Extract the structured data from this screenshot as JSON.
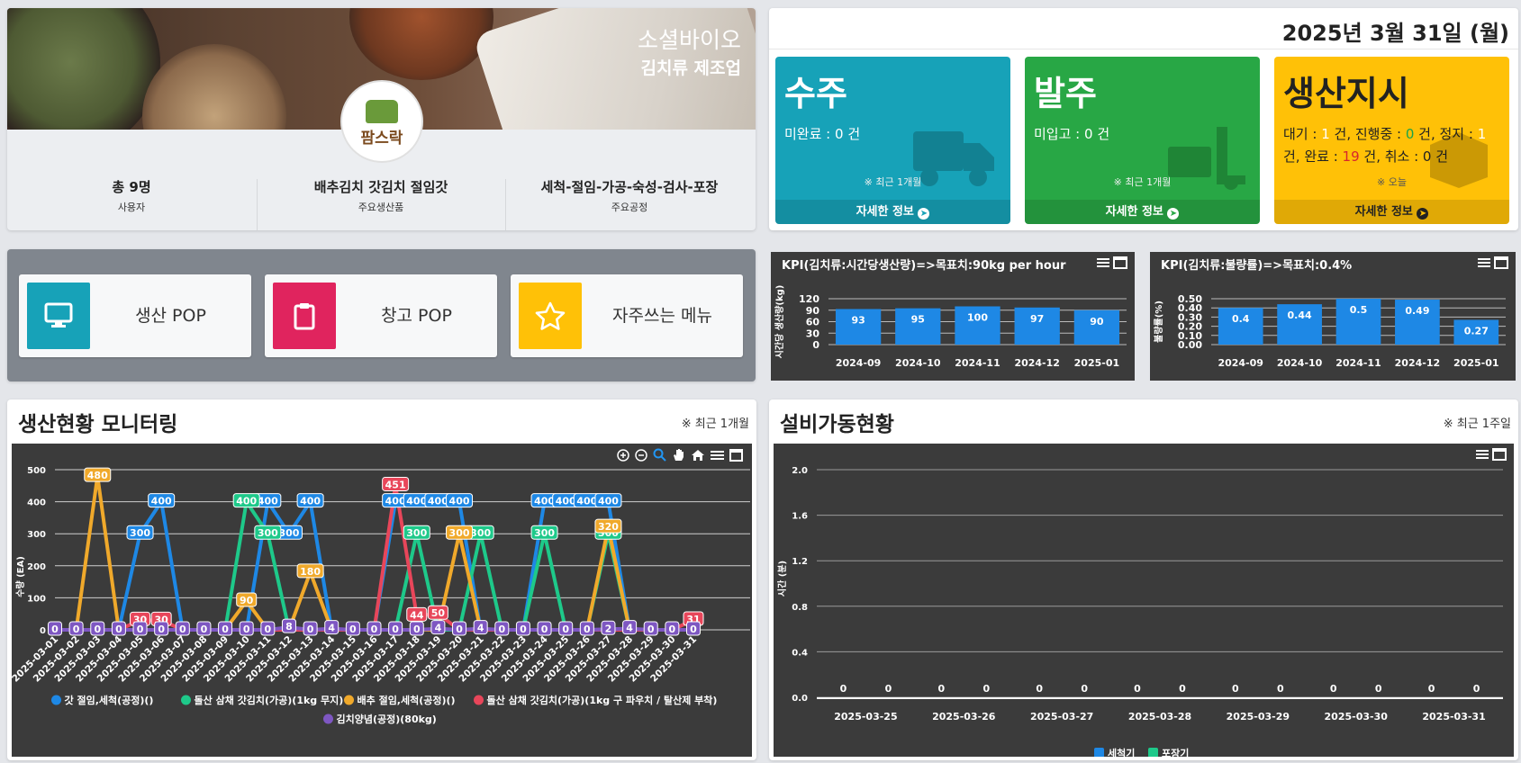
{
  "company": {
    "name": "소셜바이오",
    "industry": "김치류 제조업"
  },
  "logo_text": "팜스락",
  "stats": [
    {
      "value": "총 9명",
      "label": "사용자"
    },
    {
      "value": "배추김치 갓김치 절임갓",
      "label": "주요생산품"
    },
    {
      "value": "세척-절임-가공-숙성-검사-포장",
      "label": "주요공정"
    }
  ],
  "date": "2025년 3월 31일 (월)",
  "boxes": {
    "order": {
      "title": "수주",
      "desc_label": "미완료 : ",
      "count": "0",
      "unit": " 건",
      "period": "※ 최근 1개월",
      "more": "자세한 정보",
      "color": "#17a2b8"
    },
    "purchase": {
      "title": "발주",
      "desc_label": "미입고 : ",
      "count": "0",
      "unit": " 건",
      "period": "※ 최근 1개월",
      "more": "자세한 정보",
      "color": "#28a745"
    },
    "production": {
      "title": "생산지시",
      "wait_label": "대기 : ",
      "wait": "1",
      "progress_label": " 건, 진행중 : ",
      "progress": "0",
      "stop_label": " 건, 정지 : ",
      "stop": "1",
      "done_label": " 건, 완료 : ",
      "done": "19",
      "cancel_label": " 건, 취소 : ",
      "cancel": "0",
      "unit": " 건",
      "period": "※ 오늘",
      "more": "자세한 정보",
      "color": "#ffc107"
    }
  },
  "pop_buttons": [
    {
      "label": "생산 POP",
      "icon": "monitor-icon",
      "color": "#17a2b8"
    },
    {
      "label": "창고 POP",
      "icon": "clipboard-icon",
      "color": "#e0245e"
    },
    {
      "label": "자주쓰는 메뉴",
      "icon": "star-icon",
      "color": "#ffc107"
    }
  ],
  "monitor_title": "생산현황 모니터링",
  "monitor_note": "※ 최근 1개월",
  "equip_title": "설비가동현황",
  "equip_note": "※ 최근 1주일",
  "chart_data": [
    {
      "type": "bar",
      "title": "KPI(김치류:시간당생산량)=>목표치:90kg per hour",
      "ylabel": "시간당 생산량(kg)",
      "categories": [
        "2024-09",
        "2024-10",
        "2024-11",
        "2024-12",
        "2025-01"
      ],
      "values": [
        93,
        95,
        100,
        97,
        90
      ],
      "yticks": [
        "0",
        "30",
        "60",
        "90",
        "120"
      ],
      "ylim": [
        0,
        120
      ],
      "color": "#1e88e5"
    },
    {
      "type": "bar",
      "title": "KPI(김치류:불량률)=>목표치:0.4%",
      "ylabel": "불량률(%)",
      "categories": [
        "2024-09",
        "2024-10",
        "2024-11",
        "2024-12",
        "2025-01"
      ],
      "values": [
        0.4,
        0.44,
        0.5,
        0.49,
        0.27
      ],
      "yticks": [
        "0.00",
        "0.10",
        "0.20",
        "0.30",
        "0.40",
        "0.50"
      ],
      "ylim": [
        0,
        0.5
      ],
      "color": "#1e88e5"
    },
    {
      "type": "line",
      "ylabel": "수량 (EA)",
      "ylim": [
        0,
        500
      ],
      "yticks": [
        "0",
        "100",
        "200",
        "300",
        "400",
        "500"
      ],
      "x": [
        "2025-03-01",
        "2025-03-02",
        "2025-03-03",
        "2025-03-04",
        "2025-03-05",
        "2025-03-06",
        "2025-03-07",
        "2025-03-08",
        "2025-03-09",
        "2025-03-10",
        "2025-03-11",
        "2025-03-12",
        "2025-03-13",
        "2025-03-14",
        "2025-03-15",
        "2025-03-16",
        "2025-03-17",
        "2025-03-18",
        "2025-03-19",
        "2025-03-20",
        "2025-03-21",
        "2025-03-22",
        "2025-03-23",
        "2025-03-24",
        "2025-03-25",
        "2025-03-26",
        "2025-03-27",
        "2025-03-28",
        "2025-03-29",
        "2025-03-30",
        "2025-03-31"
      ],
      "series": [
        {
          "name": "갓 절임,세척(공정)()",
          "color": "#1e88e5",
          "values": [
            0,
            0,
            0,
            0,
            300,
            400,
            0,
            0,
            0,
            0,
            400,
            300,
            400,
            0,
            0,
            0,
            400,
            400,
            400,
            400,
            0,
            0,
            0,
            400,
            400,
            400,
            400,
            0,
            0,
            0,
            0
          ]
        },
        {
          "name": "돌산 삼채 갓김치(가공)(1kg 무지)",
          "color": "#1ec98a",
          "values": [
            0,
            0,
            0,
            0,
            0,
            0,
            0,
            0,
            0,
            400,
            300,
            0,
            0,
            0,
            0,
            0,
            0,
            300,
            0,
            0,
            300,
            0,
            0,
            300,
            0,
            0,
            300,
            0,
            0,
            0,
            0
          ]
        },
        {
          "name": "배추 절임,세척(공정)()",
          "color": "#f0a92b",
          "values": [
            0,
            0,
            480,
            0,
            0,
            0,
            0,
            0,
            0,
            90,
            0,
            0,
            180,
            0,
            0,
            0,
            0,
            0,
            0,
            300,
            0,
            0,
            0,
            0,
            0,
            0,
            320,
            0,
            0,
            0,
            0
          ]
        },
        {
          "name": "돌산 삼채 갓김치(가공)(1kg 구 파우치 / 탈산제 부착)",
          "color": "#e8465a",
          "values": [
            0,
            0,
            0,
            0,
            30,
            30,
            0,
            0,
            0,
            0,
            0,
            0,
            0,
            0,
            0,
            0,
            451,
            44,
            50,
            0,
            0,
            0,
            0,
            0,
            0,
            0,
            0,
            0,
            0,
            0,
            31
          ]
        },
        {
          "name": "김치양념(공정)(80kg)",
          "color": "#7e57c2",
          "values": [
            0,
            0,
            0,
            0,
            0,
            0,
            0,
            0,
            0,
            0,
            0,
            8,
            0,
            4,
            0,
            0,
            0,
            0,
            4,
            0,
            4,
            0,
            0,
            0,
            0,
            0,
            2,
            4,
            0,
            0,
            0
          ]
        }
      ]
    },
    {
      "type": "bar",
      "ylabel": "시간 (분)",
      "ylim": [
        0,
        2.0
      ],
      "yticks": [
        "0.0",
        "0.4",
        "0.8",
        "1.2",
        "1.6",
        "2.0"
      ],
      "categories": [
        "2025-03-25",
        "2025-03-26",
        "2025-03-27",
        "2025-03-28",
        "2025-03-29",
        "2025-03-30",
        "2025-03-31"
      ],
      "series": [
        {
          "name": "세척기",
          "color": "#1e88e5",
          "values": [
            0,
            0,
            0,
            0,
            0,
            0,
            0
          ]
        },
        {
          "name": "포장기",
          "color": "#1ec98a",
          "values": [
            0,
            0,
            0,
            0,
            0,
            0,
            0
          ]
        }
      ]
    }
  ]
}
